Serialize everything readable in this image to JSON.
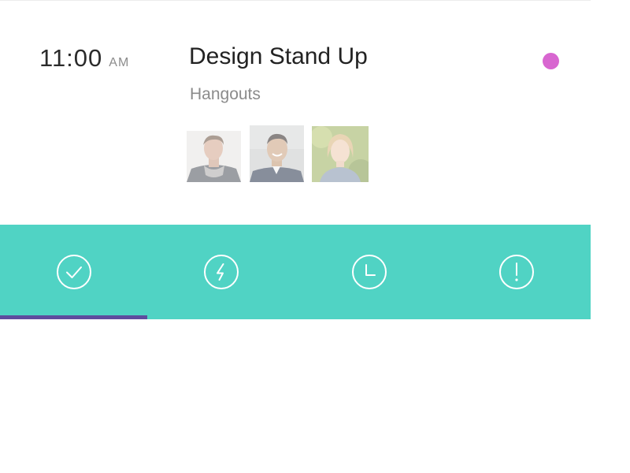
{
  "event": {
    "time": "11:00",
    "period": "AM",
    "title": "Design Stand Up",
    "location": "Hangouts",
    "status_color": "#d866d0",
    "attendees": [
      {
        "name": "attendee-1"
      },
      {
        "name": "attendee-2"
      },
      {
        "name": "attendee-3"
      }
    ]
  },
  "action_bar": {
    "background": "#50d3c4",
    "indicator_color": "#5d4c9e",
    "active_index": 0,
    "actions": [
      {
        "icon": "check-circle-icon"
      },
      {
        "icon": "lightning-circle-icon"
      },
      {
        "icon": "clock-icon"
      },
      {
        "icon": "alert-circle-icon"
      }
    ]
  }
}
